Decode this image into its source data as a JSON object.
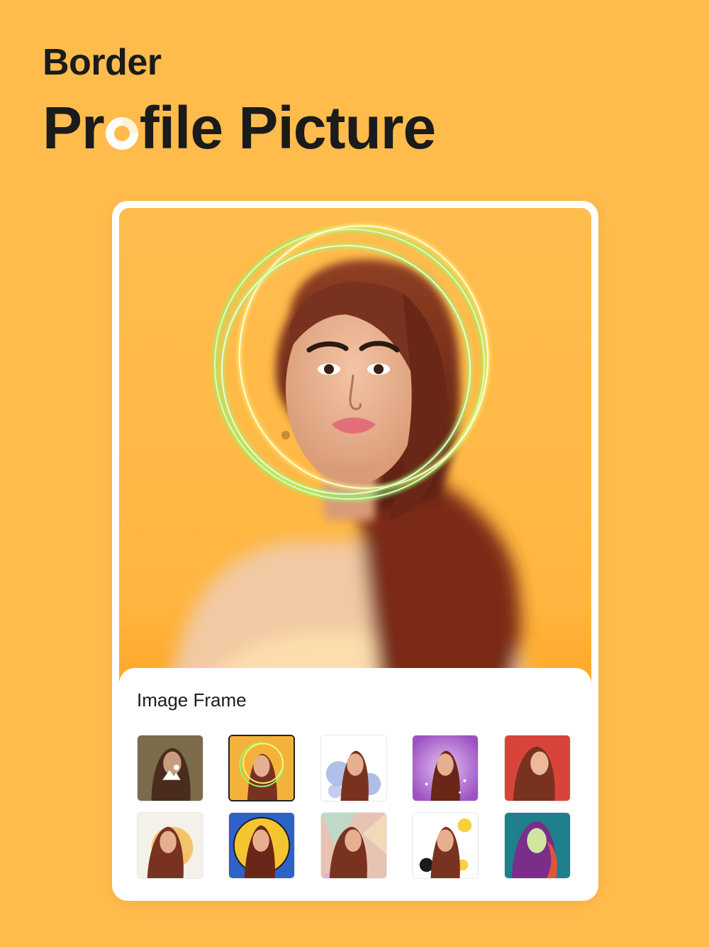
{
  "header": {
    "line1": "Border",
    "line2_part1": "Pr",
    "line2_part2": "file Picture"
  },
  "panel": {
    "title": "Image Frame"
  },
  "frames": [
    {
      "name": "gallery",
      "bg": "#7B6B4A",
      "selected": false,
      "icon": "image-icon"
    },
    {
      "name": "neon-ring",
      "bg": "#F5B23A",
      "selected": true
    },
    {
      "name": "blue-splash",
      "bg": "#ffffff",
      "selected": false
    },
    {
      "name": "purple-glow",
      "bg": "#B36BD1",
      "selected": false
    },
    {
      "name": "red-solid",
      "bg": "#D9443A",
      "selected": false
    },
    {
      "name": "watercolor-orange",
      "bg": "#F4F0EA",
      "selected": false
    },
    {
      "name": "blue-circle",
      "bg": "#2E62C8",
      "selected": false
    },
    {
      "name": "pastel-geometric",
      "bg": "#E7C3B3",
      "selected": false
    },
    {
      "name": "yellow-ink-splash",
      "bg": "#ffffff",
      "selected": false
    },
    {
      "name": "teal-popart",
      "bg": "#1F7F8C",
      "selected": false
    }
  ],
  "colors": {
    "background": "#FFBC4D",
    "text": "#1b1b1b",
    "ring_green": "#8CFF6A",
    "ring_yellow": "#FFF27A"
  }
}
